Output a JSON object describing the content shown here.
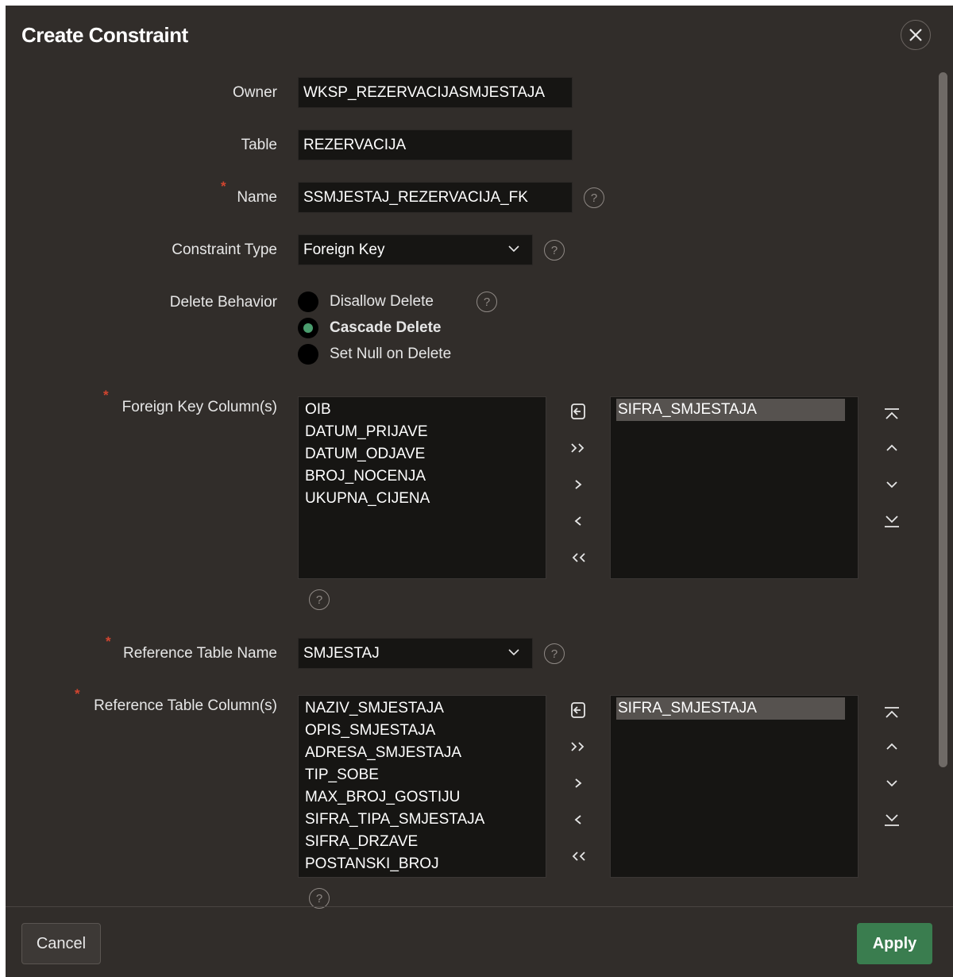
{
  "dialog": {
    "title": "Create Constraint",
    "close_icon": "close-icon"
  },
  "form": {
    "owner": {
      "label": "Owner",
      "value": "WKSP_REZERVACIJASMJESTAJA"
    },
    "table": {
      "label": "Table",
      "value": "REZERVACIJA"
    },
    "name": {
      "label": "Name",
      "value": "SSMJESTAJ_REZERVACIJA_FK",
      "required": true
    },
    "constraint_type": {
      "label": "Constraint Type",
      "value": "Foreign Key"
    },
    "delete_behavior": {
      "label": "Delete Behavior",
      "options": [
        {
          "label": "Disallow Delete",
          "selected": false
        },
        {
          "label": "Cascade Delete",
          "selected": true
        },
        {
          "label": "Set Null on Delete",
          "selected": false
        }
      ]
    },
    "fk_columns": {
      "label": "Foreign Key Column(s)",
      "available": [
        "OIB",
        "DATUM_PRIJAVE",
        "DATUM_ODJAVE",
        "BROJ_NOCENJA",
        "UKUPNA_CIJENA"
      ],
      "selected": [
        "SIFRA_SMJESTAJA"
      ]
    },
    "ref_table": {
      "label": "Reference Table Name",
      "value": "SMJESTAJ"
    },
    "ref_columns": {
      "label": "Reference Table Column(s)",
      "available": [
        "NAZIV_SMJESTAJA",
        "OPIS_SMJESTAJA",
        "ADRESA_SMJESTAJA",
        "TIP_SOBE",
        "MAX_BROJ_GOSTIJU",
        "SIFRA_TIPA_SMJESTAJA",
        "SIFRA_DRZAVE",
        "POSTANSKI_BROJ"
      ],
      "selected": [
        "SIFRA_SMJESTAJA"
      ]
    },
    "help_glyph": "?"
  },
  "shuttle_controls": {
    "reset": "reset-icon",
    "move_all": "move-all-icon",
    "move": "move-icon",
    "remove": "remove-icon",
    "remove_all": "remove-all-icon",
    "top": "move-top-icon",
    "up": "move-up-icon",
    "down": "move-down-icon",
    "bottom": "move-bottom-icon"
  },
  "footer": {
    "cancel_label": "Cancel",
    "apply_label": "Apply"
  },
  "colors": {
    "background": "#312d2a",
    "field": "#161513",
    "accent": "#3a7d4f",
    "required": "#d2452f"
  }
}
